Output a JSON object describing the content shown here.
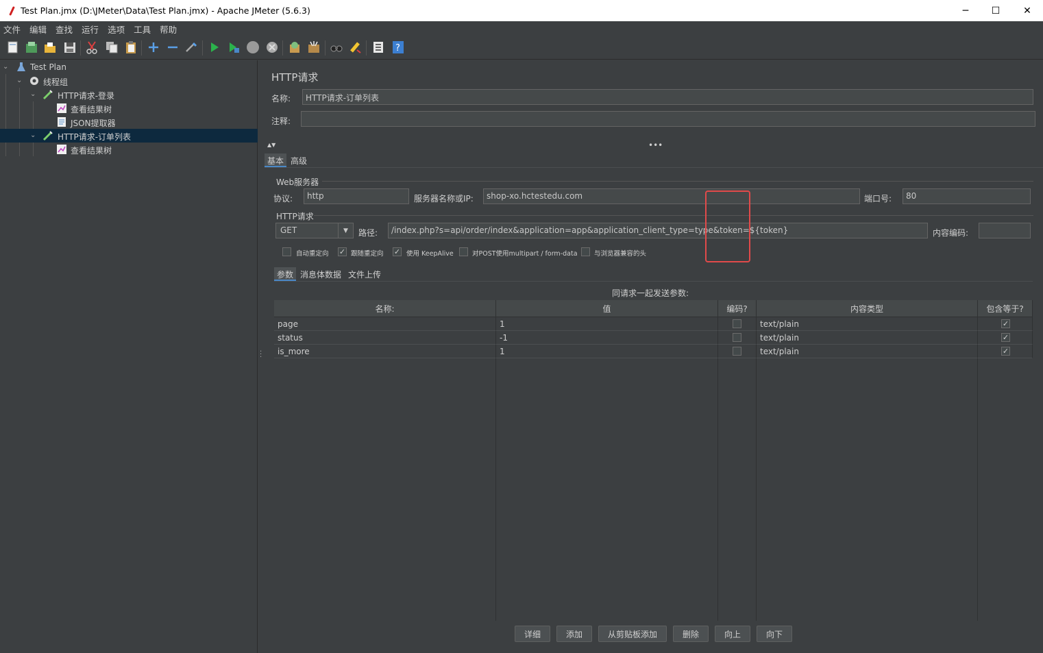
{
  "window": {
    "title": "Test Plan.jmx (D:\\JMeter\\Data\\Test Plan.jmx) - Apache JMeter (5.6.3)",
    "min_glyph": "─",
    "max_glyph": "☐",
    "close_glyph": "✕"
  },
  "menu": [
    "文件",
    "编辑",
    "查找",
    "运行",
    "选项",
    "工具",
    "帮助"
  ],
  "toolbar_icons": [
    "new-icon",
    "templates-icon",
    "open-icon",
    "save-icon",
    "cut-icon",
    "copy-icon",
    "paste-icon",
    "expand-icon",
    "collapse-icon",
    "toggle-icon",
    "start-icon",
    "start-no-pause-icon",
    "stop-icon",
    "shutdown-icon",
    "clear-icon",
    "clear-all-icon",
    "search-icon",
    "reset-search-icon",
    "function-helper-icon",
    "help-icon"
  ],
  "tree": {
    "items": [
      {
        "label": "Test Plan"
      },
      {
        "label": "线程组"
      },
      {
        "label": "HTTP请求-登录"
      },
      {
        "label": "查看结果树"
      },
      {
        "label": "JSON提取器"
      },
      {
        "label": "HTTP请求-订单列表"
      },
      {
        "label": "查看结果树"
      }
    ]
  },
  "panel": {
    "title": "HTTP请求",
    "name_label": "名称:",
    "name_value": "HTTP请求-订单列表",
    "comment_label": "注释:",
    "comment_value": "",
    "tabs": [
      "基本",
      "高级"
    ],
    "web_server": {
      "group_label": "Web服务器",
      "protocol_label": "协议:",
      "protocol_value": "http",
      "server_label": "服务器名称或IP:",
      "server_value": "shop-xo.hctestedu.com",
      "port_label": "端口号:",
      "port_value": "80"
    },
    "http_request": {
      "group_label": "HTTP请求",
      "method": "GET",
      "path_label": "路径:",
      "path_value": "/index.php?s=api/order/index&application=app&application_client_type=type&token=${token}",
      "encoding_label": "内容编码:",
      "encoding_value": ""
    },
    "options": [
      {
        "label": "自动重定向",
        "checked": false
      },
      {
        "label": "跟随重定向",
        "checked": true
      },
      {
        "label": "使用 KeepAlive",
        "checked": true
      },
      {
        "label": "对POST使用multipart / form-data",
        "checked": false
      },
      {
        "label": "与浏览器兼容的头",
        "checked": false
      }
    ],
    "sub_tabs": [
      "参数",
      "消息体数据",
      "文件上传"
    ],
    "params_caption": "同请求一起发送参数:",
    "columns": [
      "名称:",
      "值",
      "编码?",
      "内容类型",
      "包含等于?"
    ],
    "rows": [
      {
        "name": "page",
        "value": "1",
        "encode": false,
        "content_type": "text/plain",
        "include_equals": true
      },
      {
        "name": "status",
        "value": "-1",
        "encode": false,
        "content_type": "text/plain",
        "include_equals": true
      },
      {
        "name": "is_more",
        "value": "1",
        "encode": false,
        "content_type": "text/plain",
        "include_equals": true
      }
    ],
    "buttons": [
      "详细",
      "添加",
      "从剪贴板添加",
      "删除",
      "向上",
      "向下"
    ]
  },
  "colors": {
    "background": "#3c3f41",
    "selection": "#0d293e",
    "highlight": "#e24a4a",
    "accent": "#4a88c7"
  }
}
